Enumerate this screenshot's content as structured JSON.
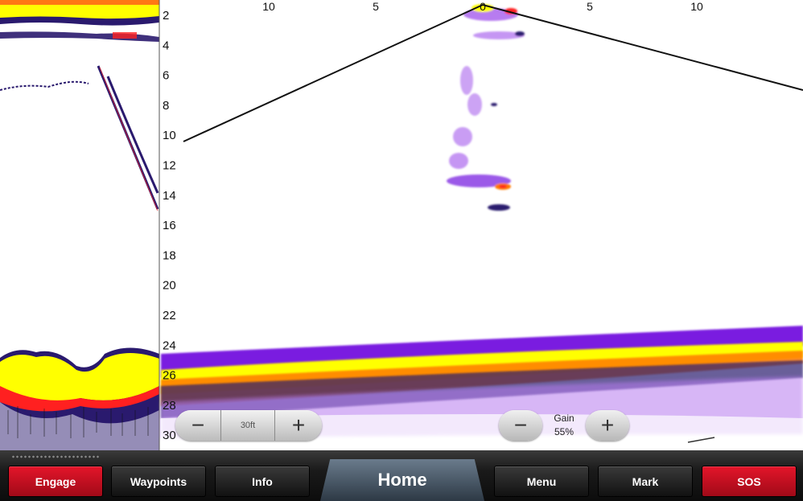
{
  "sonar": {
    "depth_labels": [
      "2",
      "4",
      "6",
      "8",
      "10",
      "12",
      "14",
      "16",
      "18",
      "20",
      "22",
      "24",
      "26",
      "28",
      "30"
    ],
    "range_labels": [
      "10",
      "5",
      "0",
      "5",
      "10"
    ]
  },
  "range_control": {
    "minus_label": "−",
    "value": "30ft",
    "plus_label": "+"
  },
  "gain_control": {
    "minus_label": "−",
    "label": "Gain",
    "value": "55%",
    "plus_label": "+"
  },
  "softkeys": {
    "engage": "Engage",
    "waypoints": "Waypoints",
    "info": "Info",
    "home": "Home",
    "menu": "Menu",
    "mark": "Mark",
    "sos": "SOS"
  },
  "colors": {
    "yellow": "#ffff00",
    "orange": "#ff7a00",
    "red": "#ff2020",
    "purple": "#7a1fe0",
    "violet": "#b77cf0",
    "navy": "#2a1a6e",
    "accent_red": "#d81224"
  }
}
